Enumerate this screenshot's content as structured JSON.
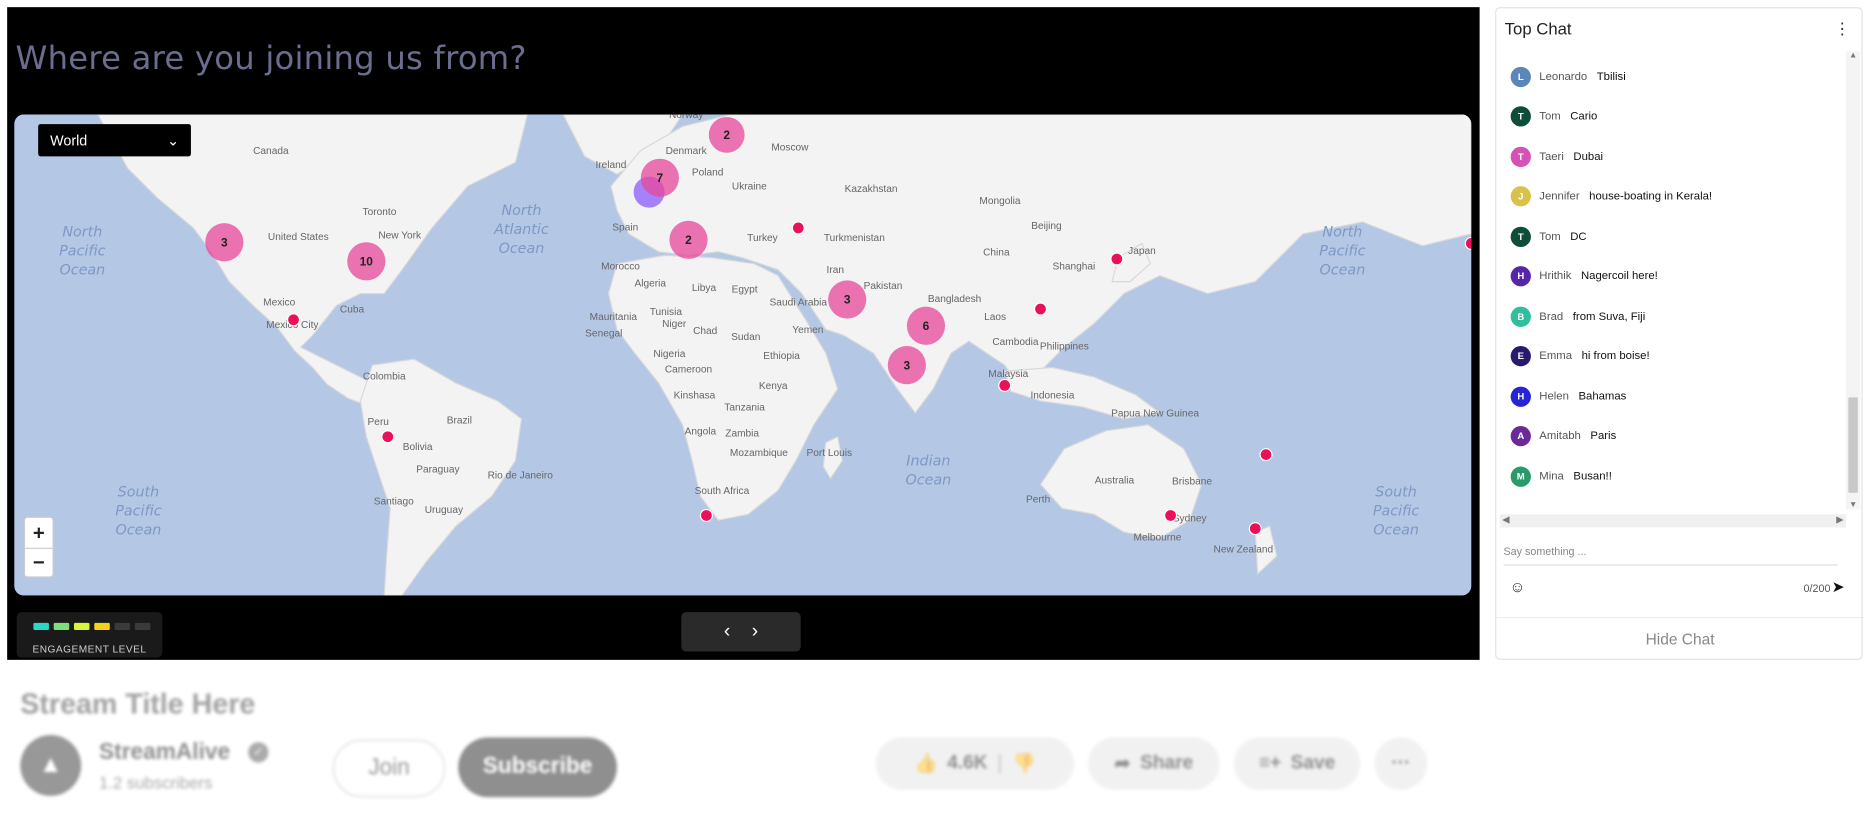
{
  "stream": {
    "question": "Where are you joining us from?",
    "region_select": {
      "value": "World"
    },
    "zoom": {
      "in_label": "+",
      "out_label": "−"
    },
    "engagement": {
      "label": "ENGAGEMENT LEVEL",
      "colors": [
        "#2fd6c7",
        "#7be07a",
        "#d8f53a",
        "#f5d21a",
        "#3a3a3a",
        "#3a3a3a"
      ]
    },
    "pager": {
      "prev": "‹",
      "next": "›"
    }
  },
  "map": {
    "ocean_labels": [
      "North Pacific Ocean",
      "North Atlantic Ocean",
      "North Pacific Ocean",
      "Indian Ocean",
      "South Pacific Ocean",
      "South Pacific Ocean"
    ],
    "place_labels": [
      "Canada",
      "United States",
      "Toronto",
      "New York",
      "Mexico",
      "Mexico City",
      "Cuba",
      "Colombia",
      "Peru",
      "Brazil",
      "Bolivia",
      "Paraguay",
      "Santiago",
      "Uruguay",
      "Rio de Janeiro",
      "Ireland",
      "Poland",
      "Ukraine",
      "Moscow",
      "Norway",
      "Denmark",
      "Spain",
      "Turkey",
      "Morocco",
      "Algeria",
      "Libya",
      "Egypt",
      "Tunisia",
      "Mauritania",
      "Niger",
      "Chad",
      "Sudan",
      "Nigeria",
      "Ethiopia",
      "Senegal",
      "Cameroon",
      "Kenya",
      "Kinshasa",
      "Tanzania",
      "Angola",
      "Zambia",
      "Mozambique",
      "Port Louis",
      "South Africa",
      "Iran",
      "Saudi Arabia",
      "Yemen",
      "Pakistan",
      "Kazakhstan",
      "Turkmenistan",
      "Mongolia",
      "Beijing",
      "China",
      "Shanghai",
      "Japan",
      "Bangladesh",
      "Laos",
      "Cambodia",
      "Philippines",
      "Malaysia",
      "Indonesia",
      "Papua New Guinea",
      "Australia",
      "Perth",
      "Brisbane",
      "Sydney",
      "Melbourne",
      "New Zealand"
    ],
    "clusters": [
      {
        "count": "3"
      },
      {
        "count": "10"
      },
      {
        "count": "7"
      },
      {
        "count": "2"
      },
      {
        "count": "2"
      },
      {
        "count": "3"
      },
      {
        "count": "6"
      },
      {
        "count": "3"
      }
    ],
    "colors": {
      "ocean": "#b4c8e6",
      "land": "#f2f2f2",
      "cluster": "#e8479a",
      "dot": "#e8115a",
      "highlight": "#8a5cff"
    }
  },
  "chat": {
    "title": "Top Chat",
    "menu_icon": "more-vert-icon",
    "messages": [
      {
        "initial": "L",
        "name": "Leonardo",
        "text": "Tbilisi",
        "color": "#5a87b8"
      },
      {
        "initial": "T",
        "name": "Tom",
        "text": "Cario",
        "color": "#0f4d3a"
      },
      {
        "initial": "T",
        "name": "Taeri",
        "text": "Dubai",
        "color": "#d651b5"
      },
      {
        "initial": "J",
        "name": "Jennifer",
        "text": "house-boating in Kerala!",
        "color": "#d9c24b"
      },
      {
        "initial": "T",
        "name": "Tom",
        "text": "DC",
        "color": "#0f4d3a"
      },
      {
        "initial": "H",
        "name": "Hrithik",
        "text": "Nagercoil here!",
        "color": "#5527a8"
      },
      {
        "initial": "B",
        "name": "Brad",
        "text": "from Suva, Fiji",
        "color": "#2fbf9a"
      },
      {
        "initial": "E",
        "name": "Emma",
        "text": "hi from boise!",
        "color": "#2a1a6e"
      },
      {
        "initial": "H",
        "name": "Helen",
        "text": "Bahamas",
        "color": "#2525d6"
      },
      {
        "initial": "A",
        "name": "Amitabh",
        "text": "Paris",
        "color": "#6a2a9a"
      },
      {
        "initial": "M",
        "name": "Mina",
        "text": "Busan!!",
        "color": "#2a9a6a"
      }
    ],
    "input": {
      "placeholder": "Say something ...",
      "counter": "0/200"
    },
    "hide_label": "Hide Chat"
  },
  "video": {
    "title": "Stream Title Here",
    "channel": "StreamAlive",
    "subscribers": "1.2 subscribers",
    "join_label": "Join",
    "subscribe_label": "Subscribe",
    "likes": "4.6K",
    "share_label": "Share",
    "save_label": "Save"
  }
}
